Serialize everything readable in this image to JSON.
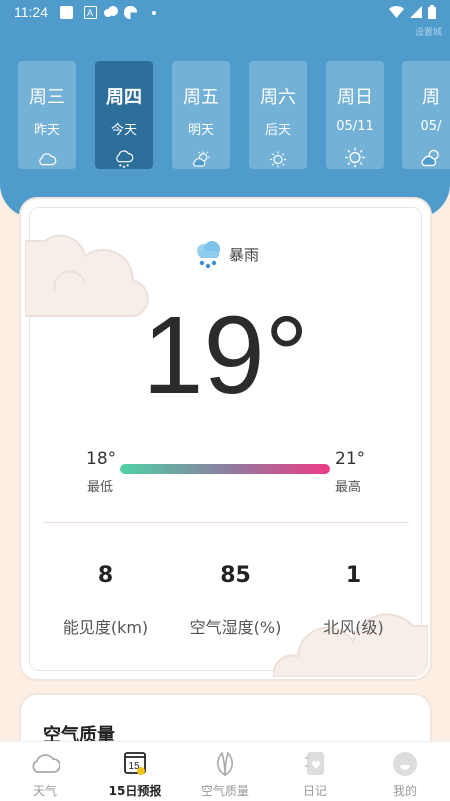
{
  "status_bar": {
    "time": "11:24"
  },
  "header": {
    "corner_label": "设置城"
  },
  "days": [
    {
      "name": "周三",
      "sub": "昨天",
      "icon": "cloud-icon"
    },
    {
      "name": "周四",
      "sub": "今天",
      "icon": "rain-cloud-icon",
      "active": true
    },
    {
      "name": "周五",
      "sub": "明天",
      "icon": "partly-cloudy-icon"
    },
    {
      "name": "周六",
      "sub": "后天",
      "icon": "sun-icon"
    },
    {
      "name": "周日",
      "sub": "05/11",
      "icon": "sun-icon"
    },
    {
      "name": "周",
      "sub": "05/",
      "icon": "partly-cloudy-icon"
    }
  ],
  "current": {
    "condition": "暴雨",
    "temperature": "19°",
    "low": "18°",
    "low_label": "最低",
    "high": "21°",
    "high_label": "最高"
  },
  "stats": [
    {
      "value": "8",
      "label": "能见度(km)"
    },
    {
      "value": "85",
      "label": "空气湿度(%)"
    },
    {
      "value": "1",
      "label": "北风(级)"
    }
  ],
  "air_quality": {
    "title": "空气质量"
  },
  "nav": [
    {
      "label": "天气",
      "icon": "cloud-icon"
    },
    {
      "label": "15日预报",
      "icon": "calendar-15-icon",
      "active": true,
      "badge": "15"
    },
    {
      "label": "空气质量",
      "icon": "leaf-icon"
    },
    {
      "label": "日记",
      "icon": "diary-icon"
    },
    {
      "label": "我的",
      "icon": "profile-icon"
    }
  ],
  "colors": {
    "header_blue": "#4e9bcc",
    "active_day": "#2c6f9b",
    "page_bg": "#fdeee3",
    "bar_start": "#4fd1a5",
    "bar_end": "#ee3b86"
  }
}
